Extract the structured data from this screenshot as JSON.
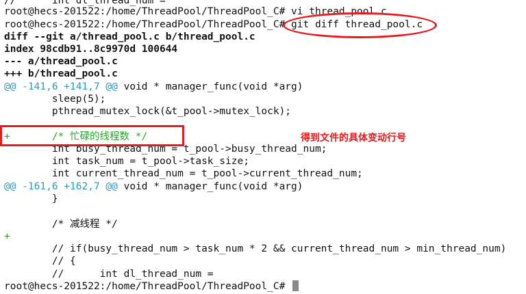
{
  "terminal": {
    "lines": [
      "//      int dl_thread_num =",
      "root@hecs-201522:/home/ThreadPool/ThreadPool_C# vi thread_pool.c",
      "root@hecs-201522:/home/ThreadPool/ThreadPool_C# git diff thread_pool.c",
      "diff --git a/thread_pool.c b/thread_pool.c",
      "index 98cdb91..8c9970d 100644",
      "--- a/thread_pool.c",
      "+++ b/thread_pool.c",
      "@@ -141,6 +141,7 @@",
      "        sleep(5);",
      "        pthread_mutex_lock(&t_pool->mutex_lock);",
      "",
      "+       /* 忙碌的线程数 */",
      "        int busy_thread_num = t_pool->busy_thread_num;",
      "        int task_num = t_pool->task_size;",
      "        int current_thread_num = t_pool->current_thread_num;",
      "@@ -161,6 +162,7 @@",
      "        }",
      "",
      "        /* 减线程 */",
      "+",
      "        // if(busy_thread_num > task_num * 2 && current_thread_num > min_thread_num)",
      "        // {",
      "        //      int dl_thread_num =",
      "root@hecs-201522:/home/ThreadPool/ThreadPool_C# "
    ],
    "hunk_contexts": [
      " void * manager_func(void *arg)",
      " void * manager_func(void *arg)"
    ]
  },
  "annotation": {
    "text": "得到文件的具体变动行号"
  },
  "colors": {
    "hunk_header": "#2a9bb8",
    "added_line": "#27a32b",
    "highlight": "#e8191c",
    "cursor": "#8a8a8a"
  }
}
